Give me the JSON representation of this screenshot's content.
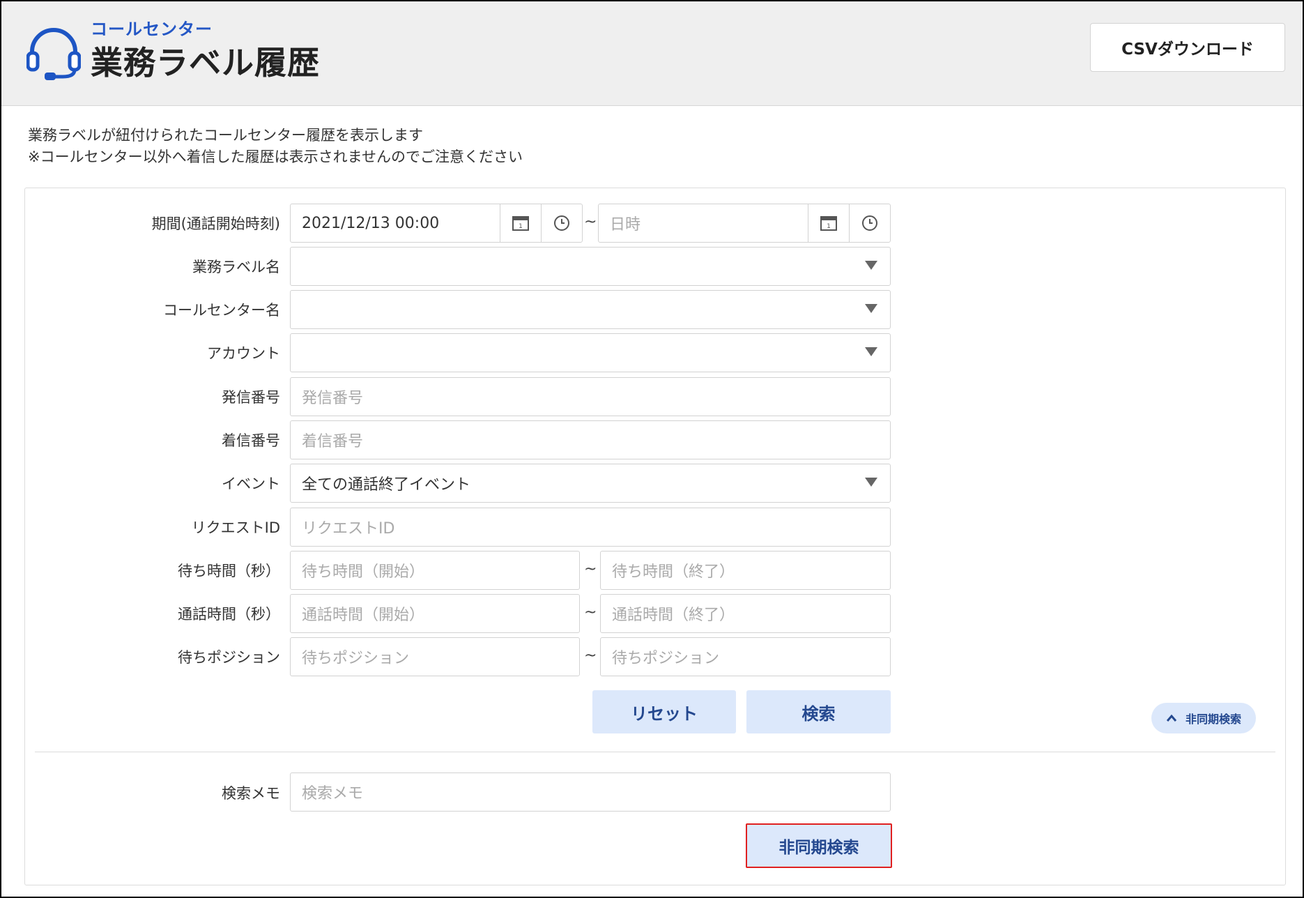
{
  "header": {
    "subtitle": "コールセンター",
    "title": "業務ラベル履歴",
    "csv_button": "CSVダウンロード",
    "icon": "headset-icon"
  },
  "description": {
    "line1": "業務ラベルが紐付けられたコールセンター履歴を表示します",
    "line2": "※コールセンター以外へ着信した履歴は表示されませんのでご注意ください"
  },
  "form": {
    "period": {
      "label": "期間(通話開始時刻)",
      "start_value": "2021/12/13 00:00",
      "end_placeholder": "日時",
      "separator": "~"
    },
    "label_name": {
      "label": "業務ラベル名",
      "value": ""
    },
    "callcenter_name": {
      "label": "コールセンター名",
      "value": ""
    },
    "account": {
      "label": "アカウント",
      "value": ""
    },
    "caller_number": {
      "label": "発信番号",
      "placeholder": "発信番号"
    },
    "callee_number": {
      "label": "着信番号",
      "placeholder": "着信番号"
    },
    "event": {
      "label": "イベント",
      "value": "全ての通話終了イベント"
    },
    "request_id": {
      "label": "リクエストID",
      "placeholder": "リクエストID"
    },
    "wait_time": {
      "label": "待ち時間（秒）",
      "start_placeholder": "待ち時間（開始）",
      "end_placeholder": "待ち時間（終了）",
      "separator": "~"
    },
    "talk_time": {
      "label": "通話時間（秒）",
      "start_placeholder": "通話時間（開始）",
      "end_placeholder": "通話時間（終了）",
      "separator": "~"
    },
    "wait_position": {
      "label": "待ちポジション",
      "start_placeholder": "待ちポジション",
      "end_placeholder": "待ちポジション",
      "separator": "~"
    },
    "reset_button": "リセット",
    "search_button": "検索",
    "async_toggle": "非同期検索",
    "search_memo": {
      "label": "検索メモ",
      "placeholder": "検索メモ"
    },
    "async_search_button": "非同期検索"
  },
  "colors": {
    "accent": "#2457c5",
    "button_bg": "#dce8fb",
    "button_text": "#24488f",
    "highlight_border": "#e02020"
  }
}
